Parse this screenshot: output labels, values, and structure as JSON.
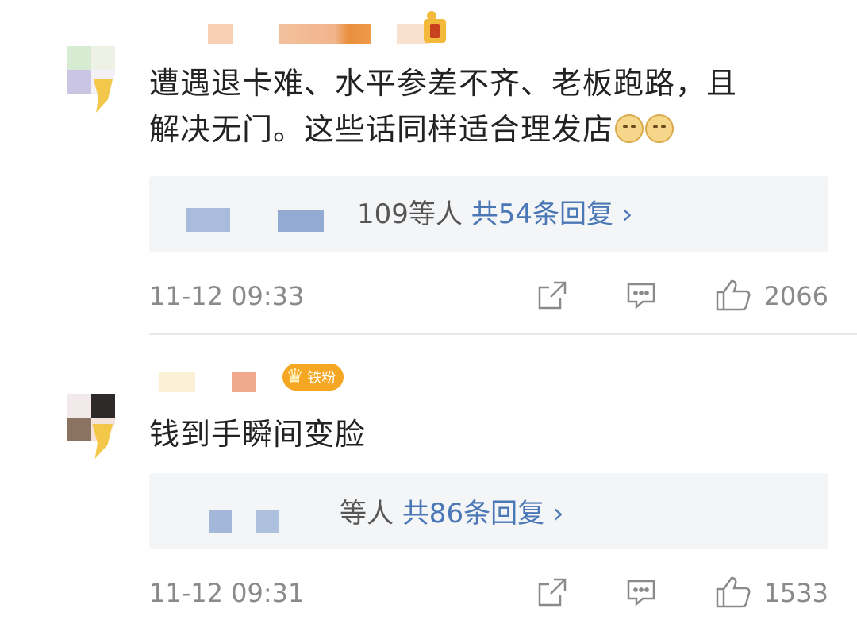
{
  "comments": [
    {
      "text_line1": "遭遇退卡难、水平参差不齐、老板跑路，且",
      "text_line2": "解决无门。这些话同样适合理发店",
      "emoji1": "doge-emoji",
      "emoji2": "doge-emoji",
      "reply_suffix": "109等人",
      "reply_count": "共54条回复",
      "reply_chevron": "›",
      "time": "11-12 09:33",
      "likes": "2066"
    },
    {
      "text": "钱到手瞬间变脸",
      "fan_badge": "铁粉",
      "reply_suffix": "等人",
      "reply_count": "共86条回复",
      "reply_chevron": "›",
      "time": "11-12 09:31",
      "likes": "1533"
    }
  ],
  "colors": {
    "link_blue": "#4a77b5",
    "meta_gray": "#8a8a8a",
    "reply_bg": "#f4f5f7",
    "fan_badge": "#f5a623"
  },
  "icons": [
    "share-icon",
    "comment-icon",
    "like-icon",
    "crown-icon",
    "vip-badge-icon"
  ]
}
